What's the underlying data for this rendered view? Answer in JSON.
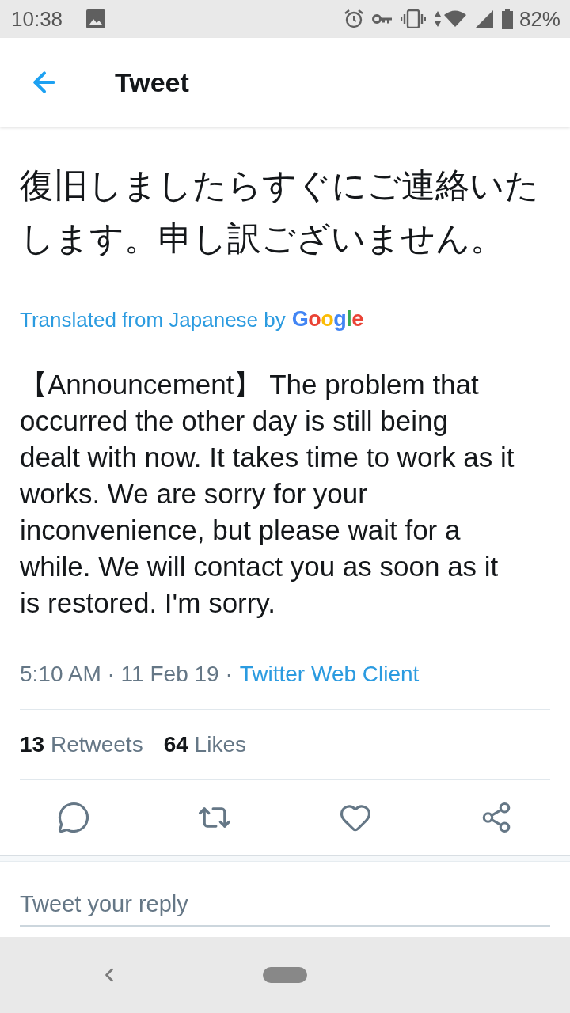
{
  "status_bar": {
    "time": "10:38",
    "battery": "82%"
  },
  "header": {
    "title": "Tweet"
  },
  "tweet": {
    "original_text": "復旧しましたらすぐにご連絡いたします。申し訳ございません。",
    "translation_label": "Translated from Japanese by",
    "translation_provider": "Google",
    "translated_text": "【Announcement】 The problem that occurred the other day is still being dealt with now. It takes time to work as it works. We are sorry for your inconvenience, but please wait for a while. We will contact you as soon as it is restored. I'm sorry.",
    "timestamp": "5:10 AM · 11 Feb 19 ·",
    "source": "Twitter Web Client",
    "stats": [
      {
        "text": "**13** Retweets"
      },
      {
        "text": "**64** Likes"
      }
    ]
  },
  "reply_box": {
    "placeholder": "Tweet your reply"
  }
}
